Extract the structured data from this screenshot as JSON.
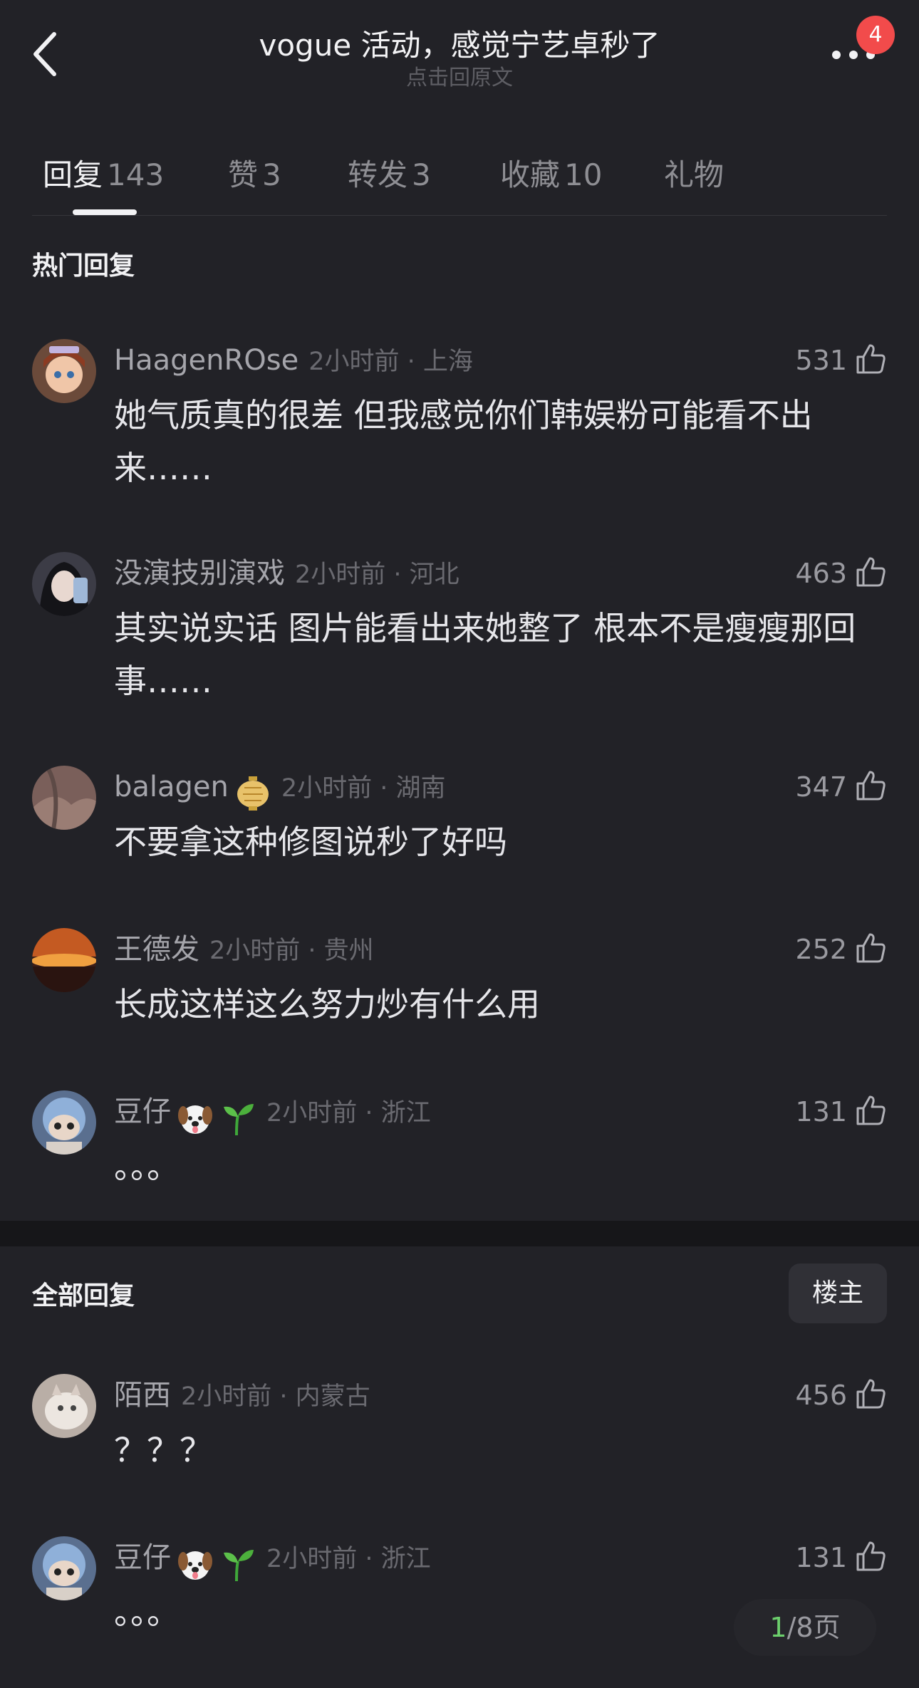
{
  "header": {
    "title": "vogue 活动，感觉宁艺卓秒了",
    "subtitle": "点击回原文",
    "badge_count": "4"
  },
  "tabs": [
    {
      "label": "回复",
      "count": "143",
      "active": true
    },
    {
      "label": "赞",
      "count": "3"
    },
    {
      "label": "转发",
      "count": "3"
    },
    {
      "label": "收藏",
      "count": "10"
    },
    {
      "label": "礼物",
      "count": ""
    }
  ],
  "hot_section": {
    "title": "热门回复",
    "comments": [
      {
        "user": "HaagenROse",
        "time": "2小时前 · 上海",
        "likes": "531",
        "text": "她气质真的很差 但我感觉你们韩娱粉可能看不出来……",
        "avatar_color": "#c98a5a"
      },
      {
        "user": "没演技别演戏",
        "time": "2小时前 · 河北",
        "likes": "463",
        "text": "其实说实话 图片能看出来她整了 根本不是瘦瘦那回事……",
        "avatar_color": "#4a4a55"
      },
      {
        "user": "balagen",
        "time": "2小时前 · 湖南",
        "likes": "347",
        "text": "不要拿这种修图说秒了好吗",
        "avatar_color": "#8a6f6a",
        "emoji": "lantern-emoji"
      },
      {
        "user": "王德发",
        "time": "2小时前 · 贵州",
        "likes": "252",
        "text": "长成这样这么努力炒有什么用",
        "avatar_color": "#d9742a"
      },
      {
        "user": "豆仔",
        "time": "2小时前 · 浙江",
        "likes": "131",
        "text": "。。。",
        "avatar_color": "#7a9bc9",
        "emoji": "dog-emoji",
        "emoji2": "seedling-emoji"
      }
    ]
  },
  "all_section": {
    "title": "全部回复",
    "filter_label": "楼主",
    "comments": [
      {
        "user": "陌西",
        "time": "2小时前 · 内蒙古",
        "likes": "456",
        "text": "？？？",
        "avatar_color": "#b8a89a"
      },
      {
        "user": "豆仔",
        "time": "2小时前 · 浙江",
        "likes": "131",
        "text": "。。。",
        "avatar_color": "#7a9bc9",
        "emoji": "dog-emoji",
        "emoji2": "seedling-emoji"
      }
    ]
  },
  "pager": {
    "current": "1",
    "total_text": "/8页"
  }
}
